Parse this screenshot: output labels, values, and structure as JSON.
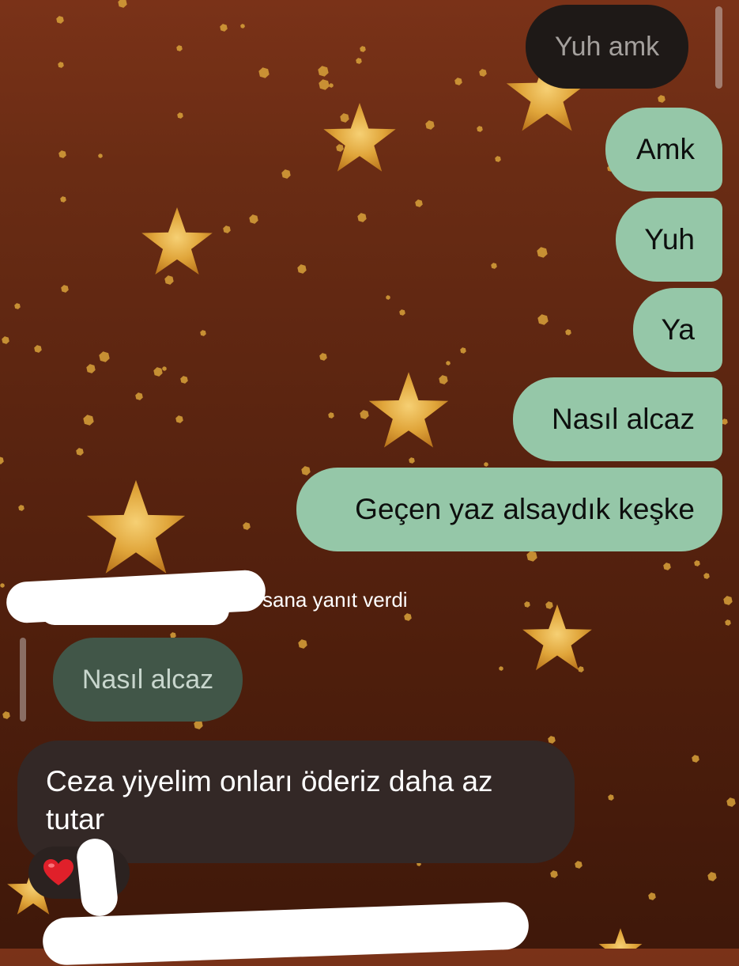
{
  "colors": {
    "sent_bubble": "#95c7a8",
    "received_bubble": "#332826",
    "quoted_dark_bubble": "#1e1917",
    "quoted_green_bubble": "#415648",
    "background_top": "#7a3218",
    "background_bottom": "#3f180a",
    "star_gold": "#e0a53a"
  },
  "chat": {
    "quoted_top": {
      "text": "Yuh amk"
    },
    "sent_messages": [
      {
        "text": "Amk"
      },
      {
        "text": "Yuh"
      },
      {
        "text": "Ya"
      },
      {
        "text": "Nasıl alcaz"
      },
      {
        "text": "Geçen yaz alsaydık keşke"
      }
    ],
    "reply_indicator": {
      "text": "sana yanıt verdi"
    },
    "reply_quote": {
      "text": "Nasıl alcaz"
    },
    "received_message": {
      "text": "Ceza yiyelim onları öderiz daha az tutar"
    },
    "reaction": {
      "emoji": "❤️"
    }
  },
  "icons": {
    "heart": "heart-icon",
    "star_decoration": "star-icon"
  }
}
